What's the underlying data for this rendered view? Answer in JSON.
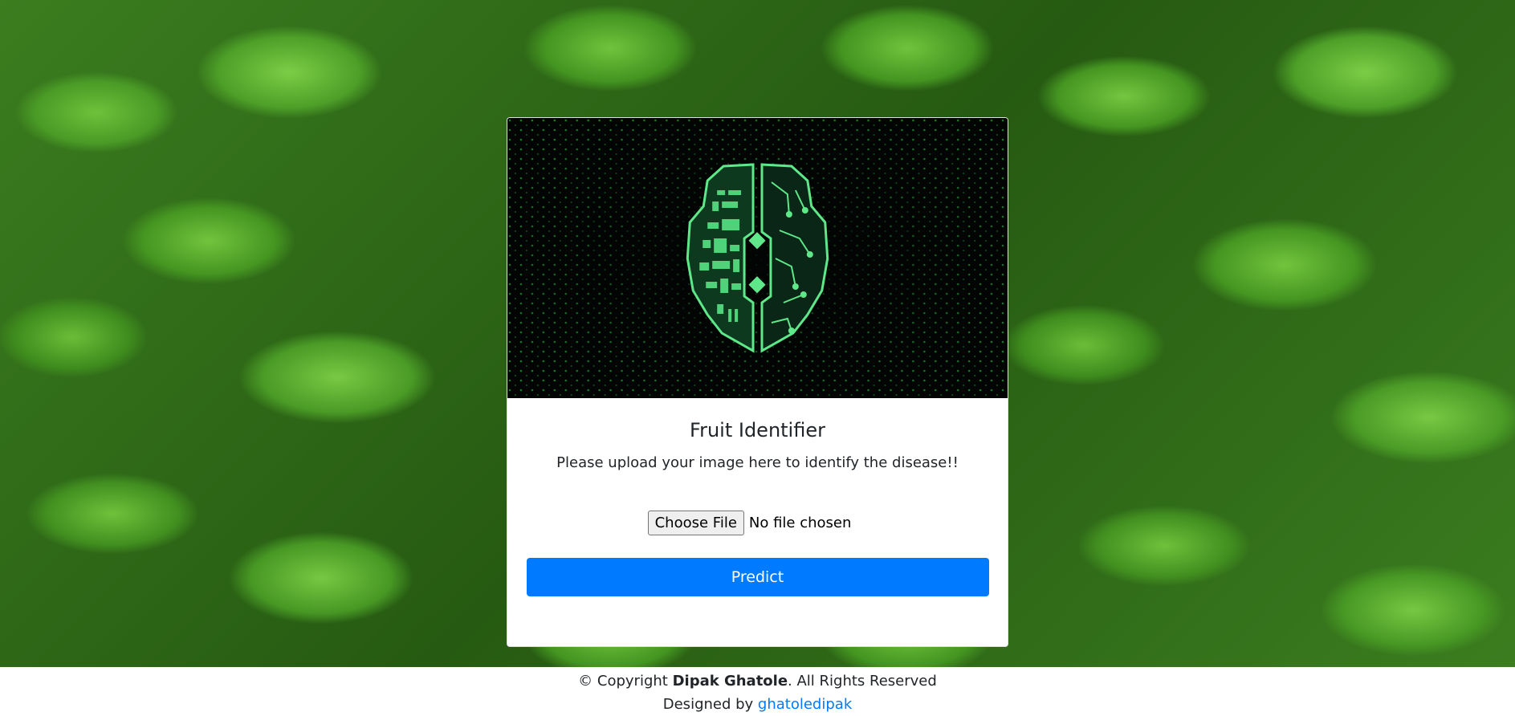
{
  "card": {
    "title": "Fruit Identifier",
    "text": "Please upload your image here to identify the disease!!",
    "file_button": "Choose File",
    "file_status": "No file chosen",
    "predict_button": "Predict"
  },
  "footer": {
    "copyright_prefix": "© Copyright ",
    "owner": "Dipak Ghatole",
    "rights": ". All Rights Reserved",
    "designed_by": "Designed by ",
    "designer_link": "ghatoledipak"
  },
  "colors": {
    "primary": "#007bff",
    "link": "#007bff",
    "leaf_green": "#4a9a26",
    "circuit_green": "#5fe88a"
  },
  "icons": {
    "hero": "ai-brain-circuit-image",
    "background": "leaf-background-image"
  }
}
